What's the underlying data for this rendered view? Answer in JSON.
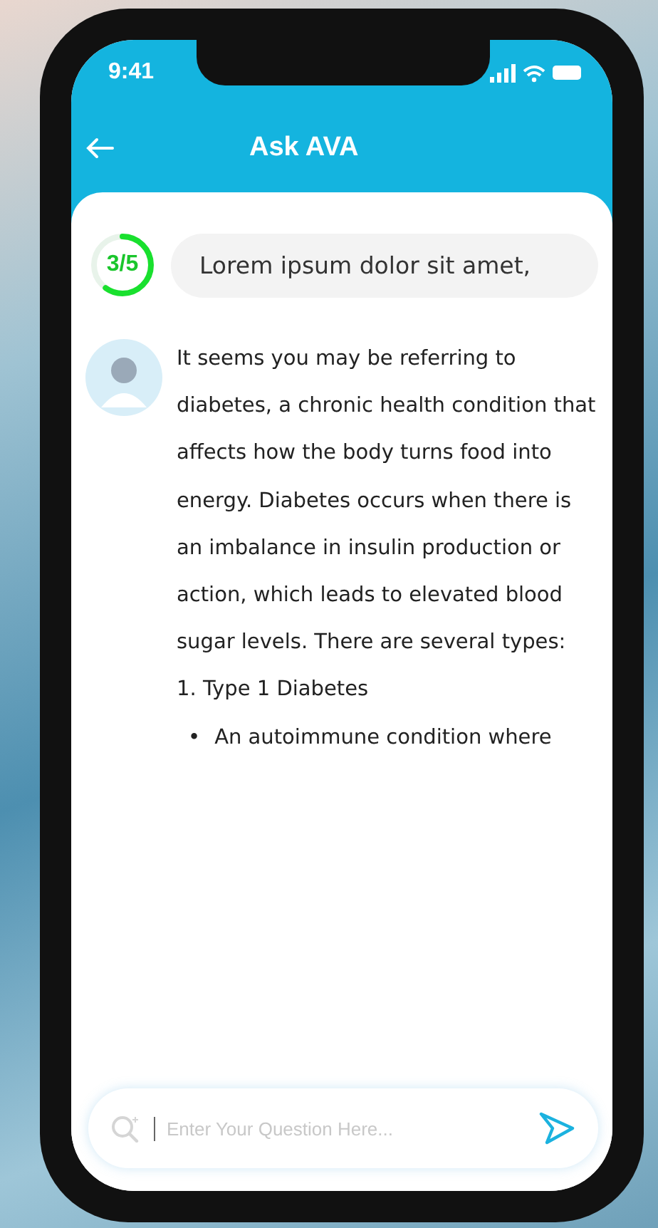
{
  "status_bar": {
    "time": "9:41"
  },
  "header": {
    "title": "Ask AVA"
  },
  "question": {
    "counter": "3/5",
    "level": 0.6,
    "text": "Lorem ipsum dolor sit amet,"
  },
  "answer": {
    "paragraph": "It seems you may be referring to diabetes, a chronic health condition that affects how the body turns food into energy. Diabetes occurs when there is an imbalance in insulin production or action, which leads to elevated blood sugar levels. There are several types:",
    "list": [
      {
        "text": "1. Type 1 Diabetes",
        "children": [
          {
            "bullet": "•",
            "text": "An autoimmune condition where"
          }
        ]
      }
    ]
  },
  "input": {
    "placeholder": "Enter Your Question Here..."
  }
}
